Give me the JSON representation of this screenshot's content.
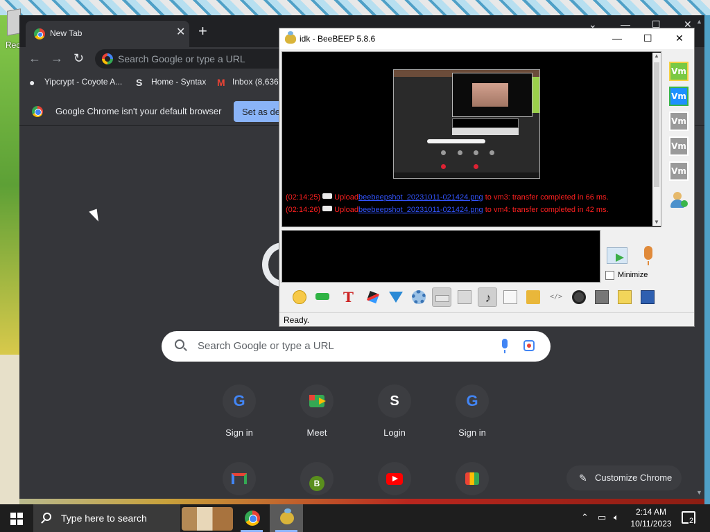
{
  "desktop": {
    "icon_label": "Rec"
  },
  "chrome": {
    "tab_title": "New Tab",
    "tab_close": "✕",
    "new_tab": "+",
    "omnibox_placeholder": "Search Google or type a URL",
    "bookmarks": [
      {
        "label": "Yipcrypt - Coyote A...",
        "icon": "globe-icon"
      },
      {
        "label": "Home - Syntax",
        "icon": "syntax-s-icon"
      },
      {
        "label": "Inbox (8,636",
        "icon": "gmail-icon"
      }
    ],
    "infobar_text": "Google Chrome isn't your default browser",
    "infobar_button": "Set as default",
    "ntp_search_placeholder": "Search Google or type a URL",
    "shortcuts_row1": [
      {
        "label": "Sign in",
        "icon": "google-icon"
      },
      {
        "label": "Meet",
        "icon": "meet-icon"
      },
      {
        "label": "Login",
        "icon": "syntax-s-icon",
        "glyph": "S"
      },
      {
        "label": "Sign in",
        "icon": "google-icon"
      }
    ],
    "shortcuts_row2": [
      {
        "icon": "gmail-icon"
      },
      {
        "icon": "b-icon",
        "glyph": "B"
      },
      {
        "icon": "youtube-icon"
      },
      {
        "icon": "chrome-web-store-icon"
      }
    ],
    "customize_label": "Customize Chrome"
  },
  "beebeep": {
    "title": "idk - BeeBEEP 5.8.6",
    "messages": [
      {
        "time": "(02:14:25)",
        "action": "Upload",
        "file": "beebeepshot_20231011-021424.png",
        "rest": "to vm3: transfer completed in 66 ms."
      },
      {
        "time": "(02:14:26)",
        "action": "Upload",
        "file": "beebeepshot_20231011-021424.png",
        "rest": "to vm4: transfer completed in 42 ms."
      }
    ],
    "users": [
      {
        "label": "Vm",
        "color": "#7ac943",
        "border": "#f5d142"
      },
      {
        "label": "Vm",
        "color": "#1e90ff",
        "border": "#39b54a"
      },
      {
        "label": "Vm",
        "color": "#9a9a9a",
        "border": "#ffffff"
      },
      {
        "label": "Vm",
        "color": "#9a9a9a",
        "border": "#ffffff"
      },
      {
        "label": "Vm",
        "color": "#9a9a9a",
        "border": "#ffffff"
      }
    ],
    "minimize_label": "Minimize",
    "status": "Ready."
  },
  "taskbar": {
    "search_placeholder": "Type here to search",
    "time": "2:14 AM",
    "date": "10/11/2023",
    "notification_count": "2"
  }
}
